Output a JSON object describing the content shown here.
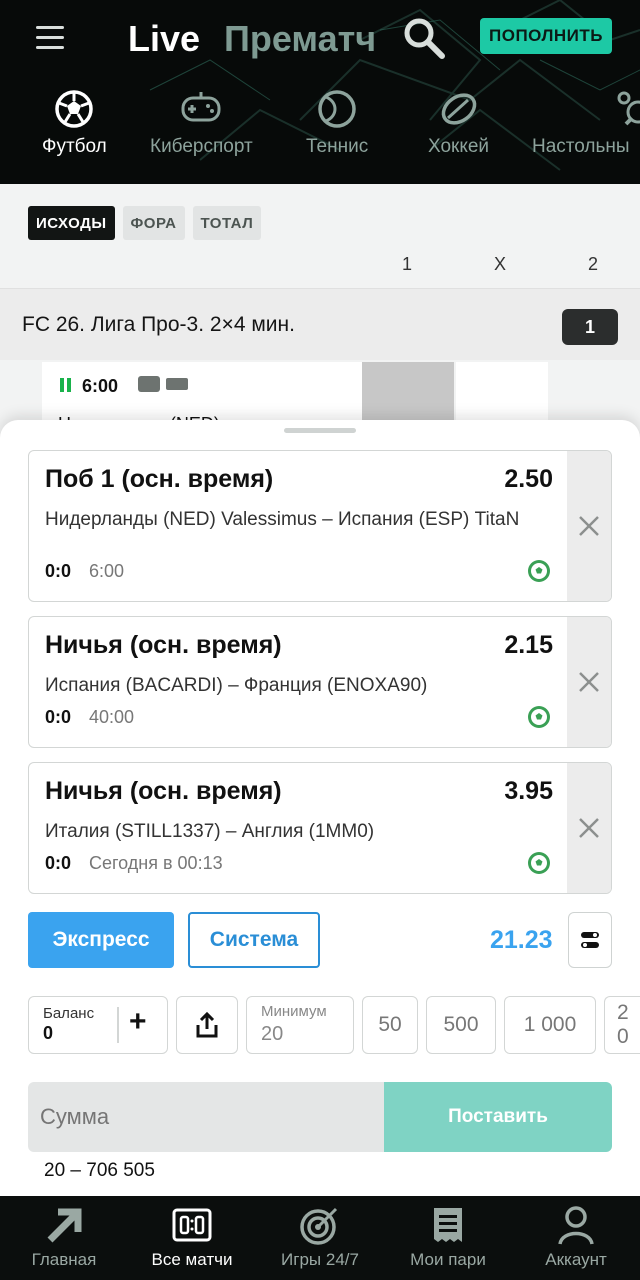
{
  "header": {
    "tabs": {
      "live": "Live",
      "prematch": "Прематч"
    },
    "deposit_label": "ПОПОЛНИТЬ",
    "sports": [
      {
        "label": "Футбол",
        "icon": "football-icon"
      },
      {
        "label": "Киберспорт",
        "icon": "gamepad-icon"
      },
      {
        "label": "Теннис",
        "icon": "tennis-icon"
      },
      {
        "label": "Хоккей",
        "icon": "hockey-puck-icon"
      },
      {
        "label": "Настольны",
        "icon": "table-tennis-icon"
      }
    ]
  },
  "filters": [
    "ИСХОДЫ",
    "ФОРА",
    "ТОТАЛ"
  ],
  "columns": [
    "1",
    "X",
    "2"
  ],
  "league": {
    "name": "FC 26. Лига Про-3. 2×4 мин.",
    "count": "1"
  },
  "match": {
    "time": "6:00",
    "teams_partial": "Нидерланды (NED)"
  },
  "betslip": {
    "bets": [
      {
        "title": "Поб 1 (осн. время)",
        "odd": "2.50",
        "teams": "Нидерланды (NED) Valessimus – Испания (ESP) TitaN",
        "score": "0:0",
        "time": "6:00"
      },
      {
        "title": "Ничья (осн. время)",
        "odd": "2.15",
        "teams": "Испания (BACARDI) – Франция (ENOXA90)",
        "score": "0:0",
        "time": "40:00"
      },
      {
        "title": "Ничья (осн. время)",
        "odd": "3.95",
        "teams": "Италия (STILL1337) – Англия (1MM0)",
        "score": "0:0",
        "time": "Сегодня в 00:13"
      }
    ],
    "type_express": "Экспресс",
    "type_system": "Система",
    "total_odd": "21.23",
    "balance": {
      "label": "Баланс",
      "value": "0"
    },
    "minimum": {
      "label": "Минимум",
      "value": "20"
    },
    "quick_amounts": [
      "50",
      "500",
      "1 000",
      "2 0"
    ],
    "stake_placeholder": "Сумма",
    "place_label": "Поставить",
    "range": "20 – 706 505"
  },
  "nav": [
    {
      "label": "Главная",
      "icon": "home-arrow-icon"
    },
    {
      "label": "Все матчи",
      "icon": "scoreboard-icon"
    },
    {
      "label": "Игры 24/7",
      "icon": "target-icon"
    },
    {
      "label": "Мои пари",
      "icon": "receipt-icon"
    },
    {
      "label": "Аккаунт",
      "icon": "user-icon"
    }
  ],
  "colors": {
    "accent": "#1dc9a5",
    "blue": "#3aa3ef",
    "live_green": "#19b24b"
  }
}
